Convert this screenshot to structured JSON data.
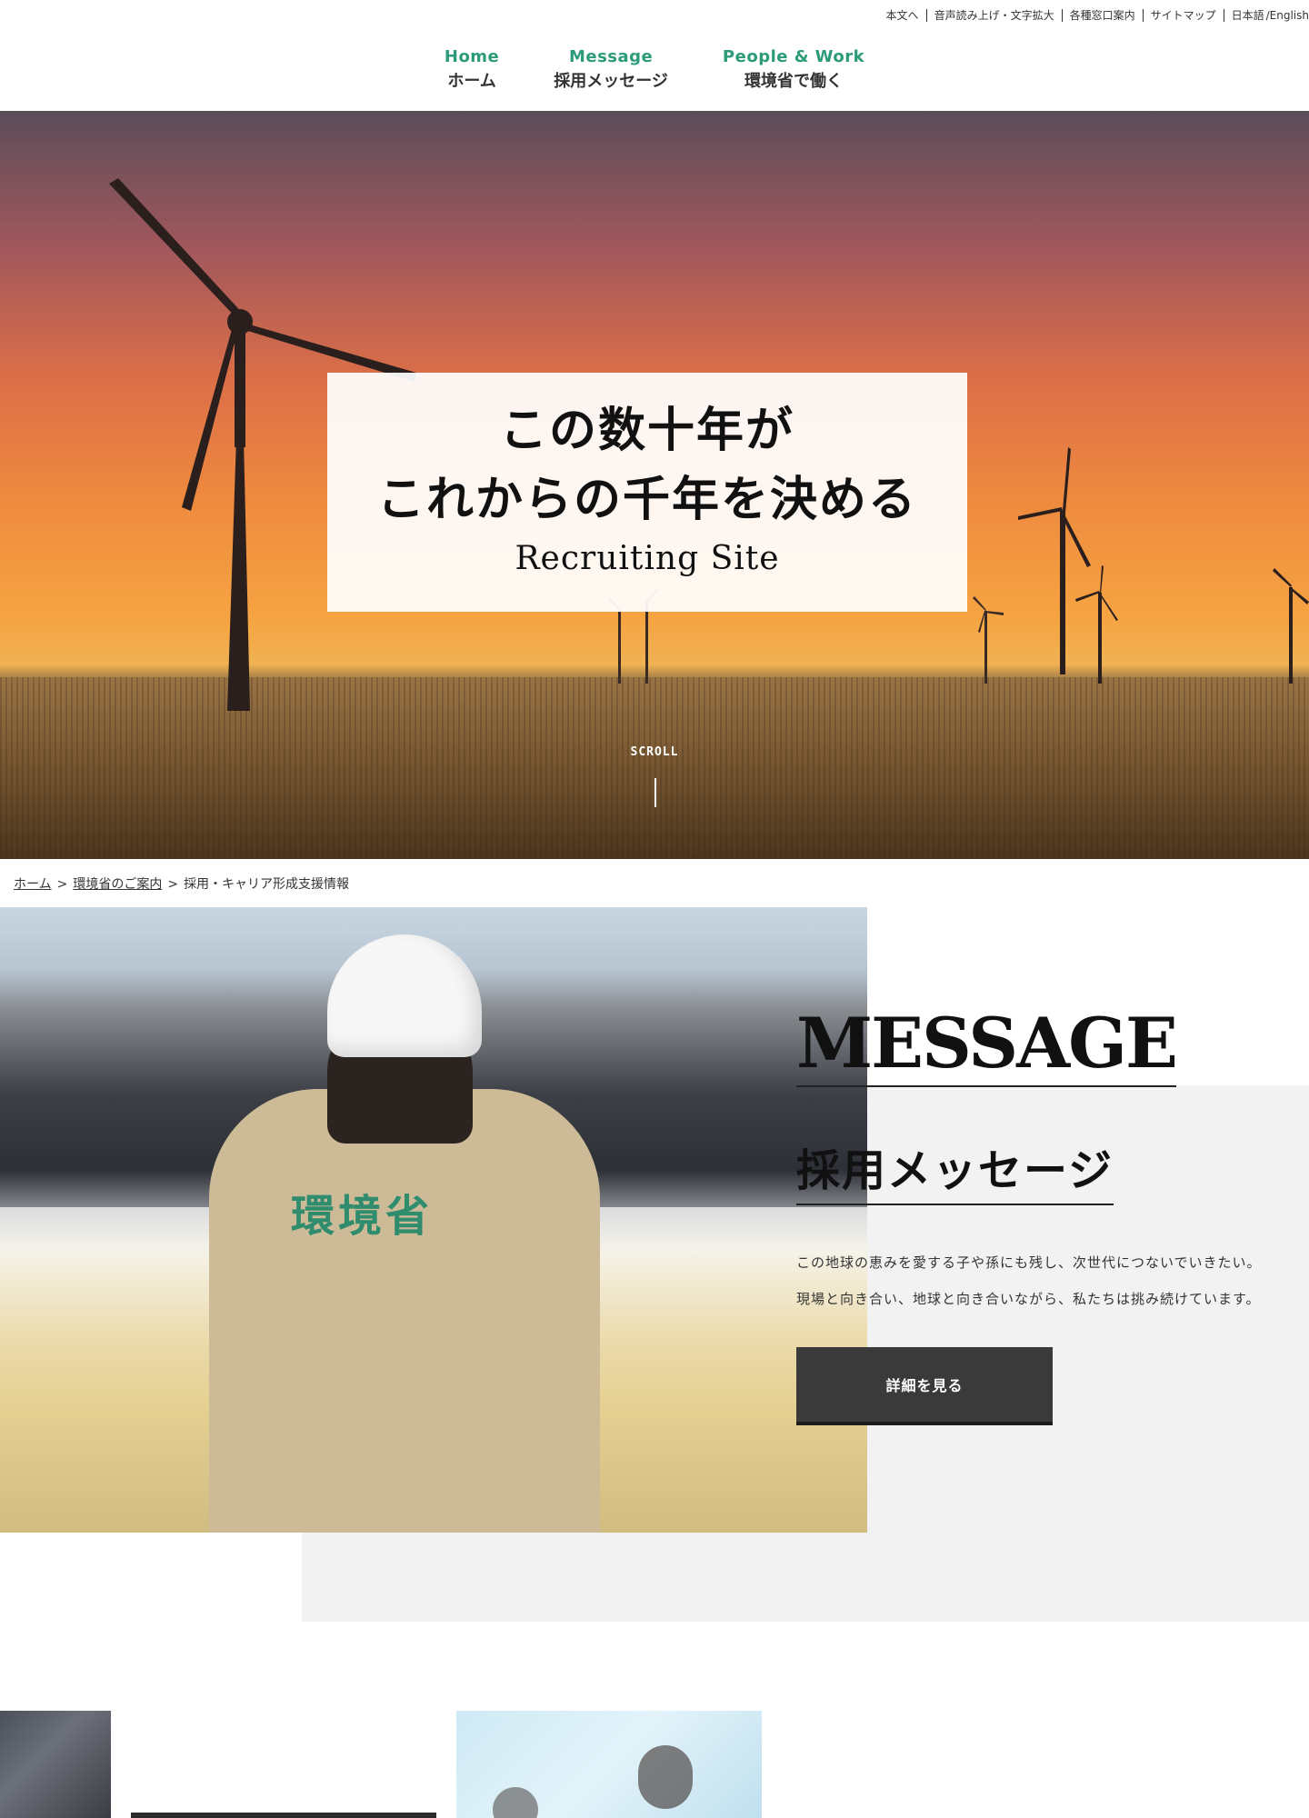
{
  "utility_nav": {
    "links": [
      "本文へ",
      "音声読み上げ・文字拡大",
      "各種窓口案内",
      "サイトマップ"
    ],
    "lang_ja": "日本語",
    "lang_en": "/English"
  },
  "global_nav": [
    {
      "en": "Home",
      "ja": "ホーム"
    },
    {
      "en": "Message",
      "ja": "採用メッセージ"
    },
    {
      "en": "People & Work",
      "ja": "環境省で働く"
    }
  ],
  "hero": {
    "title_line1": "この数十年が",
    "title_line2": "これからの千年を決める",
    "subtitle": "Recruiting Site",
    "scroll_label": "SCROLL"
  },
  "breadcrumb": {
    "items": [
      "ホーム",
      "環境省のご案内",
      "採用・キャリア形成支援情報"
    ],
    "separator": ">"
  },
  "message": {
    "heading_en": "MESSAGE",
    "heading_ja": "採用メッセージ",
    "body_line1": "この地球の恵みを愛する子や孫にも残し、次世代につないでいきたい。",
    "body_line2": "現場と向き合い、地球と向き合いながら、私たちは挑み続けています。",
    "button_label": "詳細を見る",
    "photo_jacket_text": "環境省"
  },
  "colors": {
    "accent_green": "#2c9b7a",
    "button_dark": "#3a3a3a",
    "panel_gray": "#f2f2f2"
  },
  "icons": [
    "scroll-indicator-line"
  ]
}
